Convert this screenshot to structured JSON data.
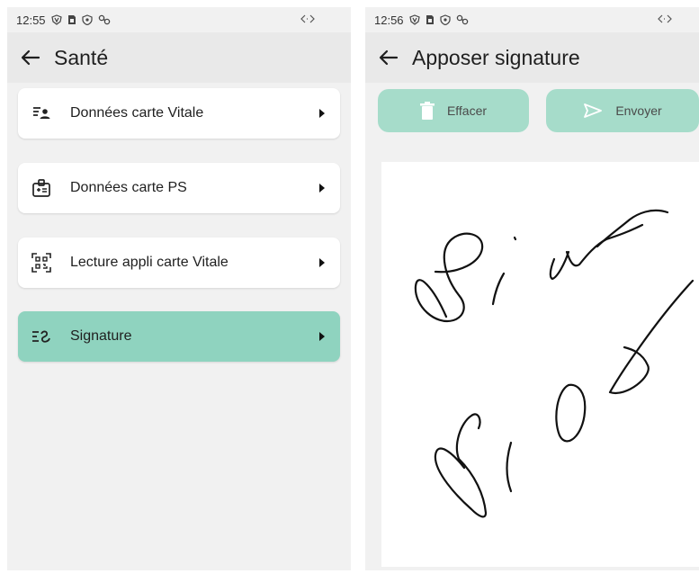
{
  "left_screen": {
    "status": {
      "time": "12:55",
      "icons": [
        "shield-v-icon",
        "sim-card-icon",
        "shield-icon",
        "link-icon"
      ],
      "right_icon": "code-arrows-icon"
    },
    "app_bar": {
      "title": "Santé",
      "back_icon": "arrow-left-icon"
    },
    "menu": [
      {
        "label": "Données carte Vitale",
        "icon": "id-list-icon",
        "active": false
      },
      {
        "label": "Données carte PS",
        "icon": "badge-icon",
        "active": false
      },
      {
        "label": "Lecture appli carte Vitale",
        "icon": "qr-scan-icon",
        "active": false
      },
      {
        "label": "Signature",
        "icon": "signature-icon",
        "active": true
      }
    ]
  },
  "right_screen": {
    "status": {
      "time": "12:56",
      "icons": [
        "shield-v-icon",
        "sim-card-icon",
        "shield-icon",
        "link-icon"
      ],
      "right_icon": "code-arrows-icon"
    },
    "app_bar": {
      "title": "Apposer signature",
      "back_icon": "arrow-left-icon"
    },
    "buttons": {
      "clear_label": "Effacer",
      "clear_icon": "trash-icon",
      "send_label": "Envoyer",
      "send_icon": "send-icon"
    }
  },
  "colors": {
    "accent": "#8fd3bf",
    "button": "#a6dcca",
    "background": "#f1f1f1",
    "app_bar": "#e9e9e9"
  }
}
